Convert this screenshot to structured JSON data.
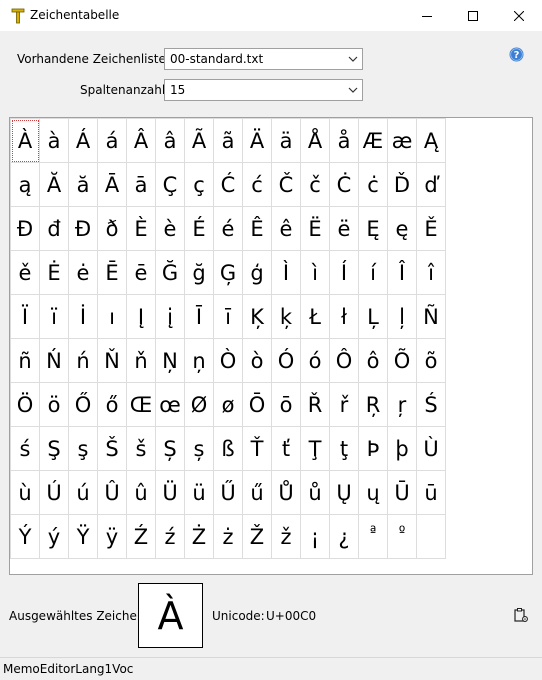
{
  "window": {
    "title": "Zeichentabelle",
    "icon": "text-tool-icon",
    "controls": [
      "minimize-icon",
      "maximize-icon",
      "close-icon"
    ]
  },
  "form": {
    "list_label": "Vorhandene Zeichenlisten:",
    "list_value": "00-standard.txt",
    "columns_label": "Spaltenanzahl:",
    "columns_value": "15"
  },
  "help_icon": "help-icon",
  "grid": {
    "columns": 15,
    "selected_index": 0,
    "chars": [
      "À",
      "à",
      "Á",
      "á",
      "Â",
      "â",
      "Ã",
      "ã",
      "Ä",
      "ä",
      "Å",
      "å",
      "Æ",
      "æ",
      "Ą",
      "ą",
      "Ă",
      "ă",
      "Ā",
      "ā",
      "Ç",
      "ç",
      "Ć",
      "ć",
      "Č",
      "č",
      "Ċ",
      "ċ",
      "Ď",
      "ď",
      "Đ",
      "đ",
      "Ð",
      "ð",
      "È",
      "è",
      "É",
      "é",
      "Ê",
      "ê",
      "Ë",
      "ë",
      "Ę",
      "ę",
      "Ě",
      "ě",
      "Ė",
      "ė",
      "Ē",
      "ē",
      "Ğ",
      "ğ",
      "Ģ",
      "ģ",
      "Ì",
      "ì",
      "Í",
      "í",
      "Î",
      "î",
      "Ï",
      "ï",
      "İ",
      "ı",
      "Į",
      "į",
      "Ī",
      "ī",
      "Ķ",
      "ķ",
      "Ł",
      "ł",
      "Ļ",
      "ļ",
      "Ñ",
      "ñ",
      "Ń",
      "ń",
      "Ň",
      "ň",
      "Ņ",
      "ņ",
      "Ò",
      "ò",
      "Ó",
      "ó",
      "Ô",
      "ô",
      "Õ",
      "õ",
      "Ö",
      "ö",
      "Ő",
      "ő",
      "Œ",
      "œ",
      "Ø",
      "ø",
      "Ō",
      "ō",
      "Ř",
      "ř",
      "Ŗ",
      "ŗ",
      "Ś",
      "ś",
      "Ş",
      "ş",
      "Š",
      "š",
      "Ș",
      "ș",
      "ß",
      "Ť",
      "ť",
      "Ţ",
      "ţ",
      "Þ",
      "þ",
      "Ù",
      "ù",
      "Ú",
      "ú",
      "Û",
      "û",
      "Ü",
      "ü",
      "Ű",
      "ű",
      "Ů",
      "ů",
      "Ų",
      "ų",
      "Ū",
      "ū",
      "Ý",
      "ý",
      "Ÿ",
      "ÿ",
      "Ź",
      "ź",
      "Ż",
      "ż",
      "Ž",
      "ž",
      "¡",
      "¿",
      "ª",
      "º"
    ]
  },
  "selection": {
    "label": "Ausgewähltes Zeichen:",
    "char": "À",
    "unicode_label": "Unicode:",
    "unicode_value": "U+00C0",
    "copy_icon": "clipboard-settings-icon"
  },
  "status": {
    "text": "MemoEditorLang1Voc"
  }
}
